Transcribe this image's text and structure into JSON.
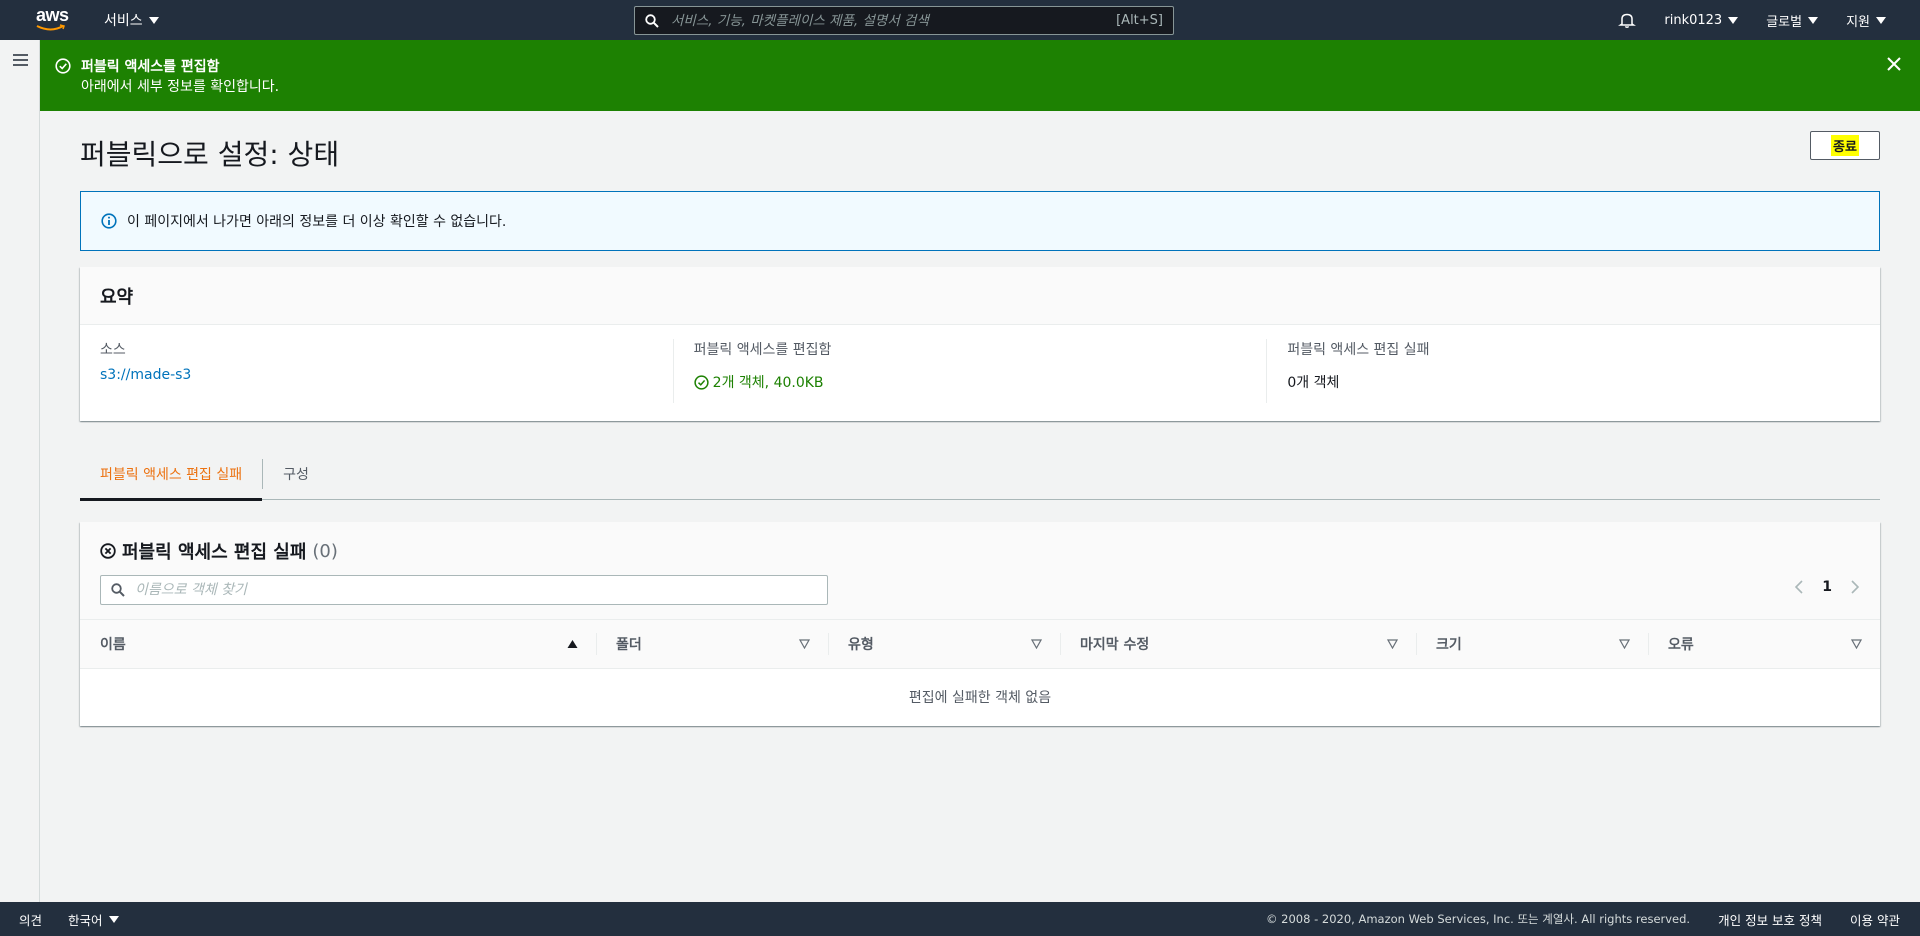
{
  "topnav": {
    "logo_text": "aws",
    "services_label": "서비스",
    "search_placeholder": "서비스, 기능, 마켓플레이스 제품, 설명서 검색",
    "search_shortcut": "[Alt+S]",
    "user_label": "rink0123",
    "region_label": "글로벌",
    "support_label": "지원"
  },
  "flash": {
    "title": "퍼블릭 액세스를 편집함",
    "message": "아래에서 세부 정보를 확인합니다."
  },
  "page": {
    "title": "퍼블릭으로 설정: 상태",
    "end_button": "종료"
  },
  "info_alert": {
    "text": "이 페이지에서 나가면 아래의 정보를 더 이상 확인할 수 없습니다."
  },
  "summary": {
    "header": "요약",
    "source_label": "소스",
    "source_value": "s3://made-s3",
    "success_label": "퍼블릭 액세스를 편집함",
    "success_value": "2개 객체, 40.0KB",
    "failed_label": "퍼블릭 액세스 편집 실패",
    "failed_value": "0개 객체"
  },
  "tabs": [
    {
      "label": "퍼블릭 액세스 편집 실패",
      "active": true
    },
    {
      "label": "구성",
      "active": false
    }
  ],
  "failed_table": {
    "title": "퍼블릭 액세스 편집 실패",
    "count": "(0)",
    "search_placeholder": "이름으로 객체 찾기",
    "page_number": "1",
    "columns": [
      "이름",
      "폴더",
      "유형",
      "마지막 수정",
      "크기",
      "오류"
    ],
    "empty_message": "편집에 실패한 객체 없음"
  },
  "footer": {
    "feedback": "의견",
    "language": "한국어",
    "copyright": "© 2008 - 2020, Amazon Web Services, Inc. 또는 계열사. All rights reserved.",
    "privacy": "개인 정보 보호 정책",
    "terms": "이용 약관"
  },
  "colors": {
    "nav_bg": "#232f3e",
    "flash_success": "#1d8102",
    "link": "#0073bb",
    "tab_active": "#ec7211",
    "highlight": "#ffff00"
  }
}
